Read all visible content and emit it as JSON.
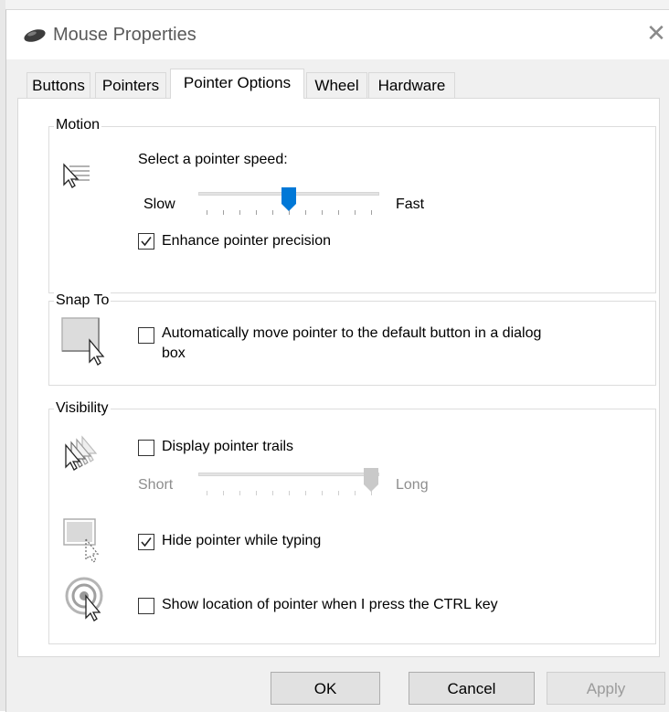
{
  "window": {
    "title": "Mouse Properties",
    "close_glyph": "✕"
  },
  "tabs": [
    "Buttons",
    "Pointers",
    "Pointer Options",
    "Wheel",
    "Hardware"
  ],
  "active_tab": "Pointer Options",
  "motion": {
    "label": "Motion",
    "speed_prompt": "Select a pointer speed:",
    "slow_label": "Slow",
    "fast_label": "Fast",
    "speed_value": 0.5,
    "enhance_label": "Enhance pointer precision",
    "enhance_checked": true,
    "icon": "pointer-speed-icon"
  },
  "snap_to": {
    "label": "Snap To",
    "auto_move_label_line1": "Automatically move pointer to the default button in a dialog",
    "auto_move_label_line2": "box",
    "auto_move_checked": false,
    "icon": "snap-to-icon"
  },
  "visibility": {
    "label": "Visibility",
    "trails_label": "Display pointer trails",
    "trails_checked": false,
    "short_label": "Short",
    "long_label": "Long",
    "trails_value": 1.0,
    "hide_label": "Hide pointer while typing",
    "hide_checked": true,
    "ctrl_label": "Show location of pointer when I press the CTRL key",
    "ctrl_checked": false,
    "icons": [
      "pointer-trails-icon",
      "hide-pointer-icon",
      "ctrl-locate-icon"
    ]
  },
  "buttons": {
    "ok": "OK",
    "cancel": "Cancel",
    "apply": "Apply"
  },
  "colors": {
    "accent": "#0078d7",
    "disabled_text": "#8e8e8e"
  }
}
